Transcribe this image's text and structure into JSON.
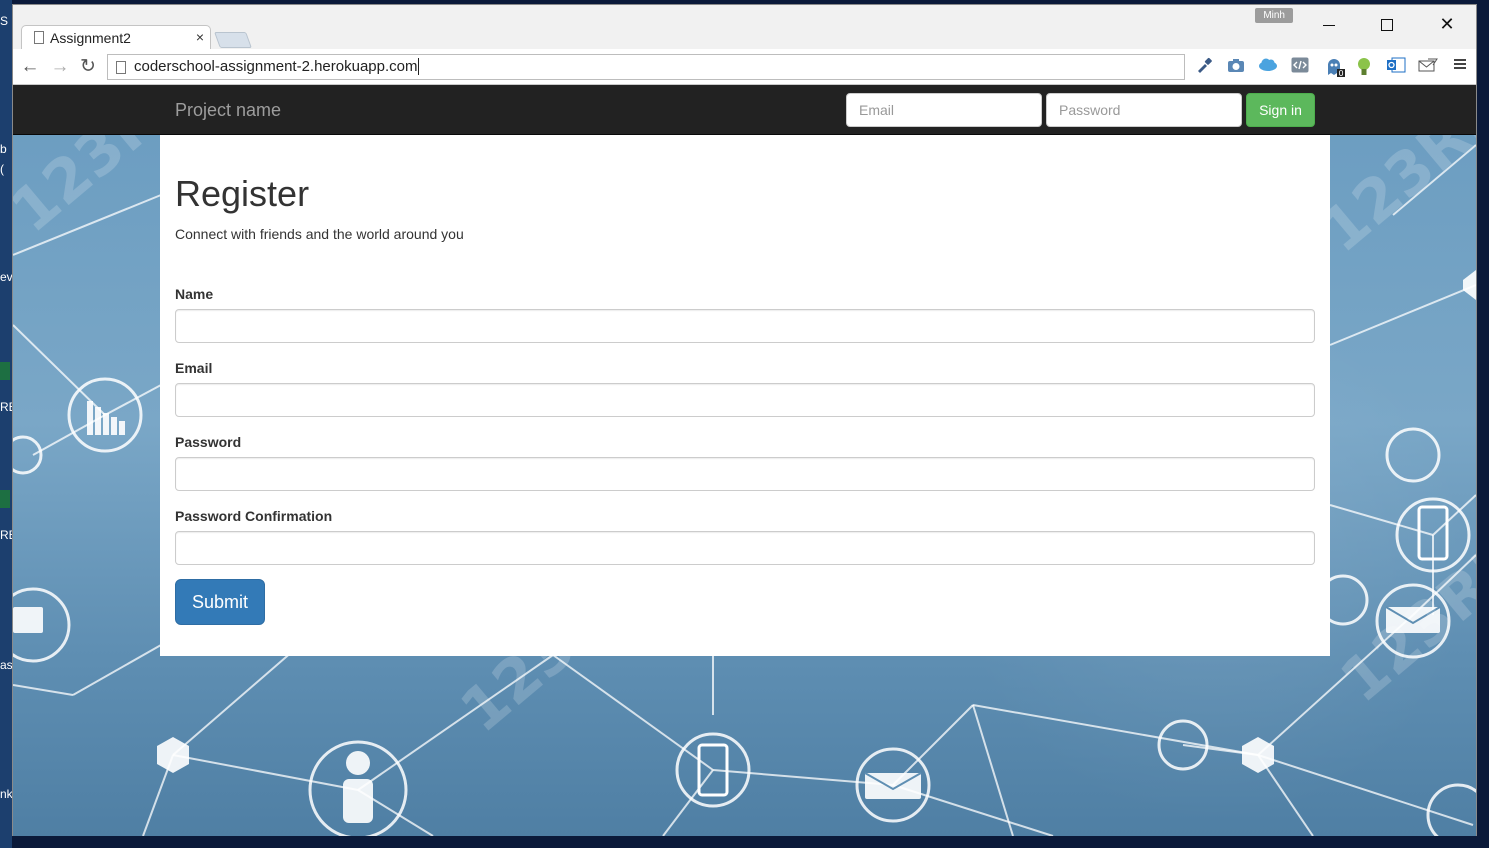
{
  "window": {
    "tab_title": "Assignment2",
    "tab_close": "×",
    "profile_name": "Minh",
    "url": "coderschool-assignment-2.herokuapp.com",
    "controls": {
      "minimize": "",
      "maximize": "",
      "close": "✕"
    }
  },
  "toolbar": {
    "back_glyph": "←",
    "forward_glyph": "→",
    "reload_glyph": "↻",
    "extensions": [
      "eyedropper-icon",
      "camera-icon",
      "cloud-icon",
      "code-icon",
      "ghost-icon",
      "bulb-icon",
      "outlook-icon",
      "mail-icon",
      "menu-icon"
    ],
    "extension_badge": "0"
  },
  "navbar": {
    "brand": "Project name",
    "email_placeholder": "Email",
    "password_placeholder": "Password",
    "signin_label": "Sign in"
  },
  "register": {
    "heading": "Register",
    "lead": "Connect with friends and the world around you",
    "fields": [
      {
        "label": "Name",
        "value": ""
      },
      {
        "label": "Email",
        "value": ""
      },
      {
        "label": "Password",
        "value": ""
      },
      {
        "label": "Password Confirmation",
        "value": ""
      }
    ],
    "submit_label": "Submit"
  },
  "colors": {
    "navbar_bg": "#222222",
    "signin_green": "#5cb85c",
    "submit_blue": "#337ab7",
    "page_bg": "#6a9cc0"
  },
  "desktop": {
    "fragments": [
      "S",
      "b",
      "(",
      "ev",
      "RE",
      "RE",
      "as",
      "nk"
    ]
  }
}
